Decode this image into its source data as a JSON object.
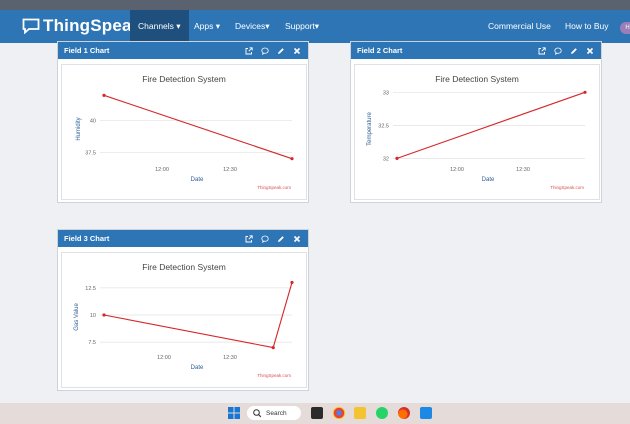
{
  "brand": {
    "name": "ThingSpeak",
    "tm": "™"
  },
  "nav": {
    "channels": "Channels ▾",
    "apps": "Apps ▾",
    "devices": "Devices▾",
    "support": "Support▾",
    "commercial": "Commercial Use",
    "how_to_buy": "How to Buy",
    "avatar": "HR"
  },
  "colors": {
    "accent": "#2e75b6",
    "line": "#d62728"
  },
  "panels": [
    {
      "header": "Field 1 Chart"
    },
    {
      "header": "Field 2 Chart"
    },
    {
      "header": "Field 3 Chart"
    }
  ],
  "chart_data": [
    {
      "type": "line",
      "title": "Fire Detection System",
      "xlabel": "Date",
      "ylabel": "Humidity",
      "credit": "ThingSpeak.com",
      "x_ticks": [
        "12:00",
        "12:30"
      ],
      "y_ticks": [
        "40",
        "37.5"
      ],
      "ylim": [
        36.5,
        42.5
      ],
      "x": [
        0,
        1
      ],
      "values": [
        42.0,
        37.0
      ]
    },
    {
      "type": "line",
      "title": "Fire Detection System",
      "xlabel": "Date",
      "ylabel": "Temperature",
      "credit": "ThingSpeak.com",
      "x_ticks": [
        "12:00",
        "12:30"
      ],
      "y_ticks": [
        "33",
        "32.5",
        "32"
      ],
      "ylim": [
        31.9,
        33.05
      ],
      "x": [
        0,
        1
      ],
      "values": [
        32.0,
        33.0
      ]
    },
    {
      "type": "line",
      "title": "Fire Detection System",
      "xlabel": "Date",
      "ylabel": "Gas Value",
      "credit": "ThingSpeak.com",
      "x_ticks": [
        "12:00",
        "12:30"
      ],
      "y_ticks": [
        "12.5",
        "10",
        "7.5"
      ],
      "ylim": [
        6.5,
        13.5
      ],
      "x": [
        0,
        0.9,
        1
      ],
      "values": [
        10.0,
        7.0,
        13.0
      ]
    }
  ],
  "taskbar": {
    "search": "Search"
  }
}
